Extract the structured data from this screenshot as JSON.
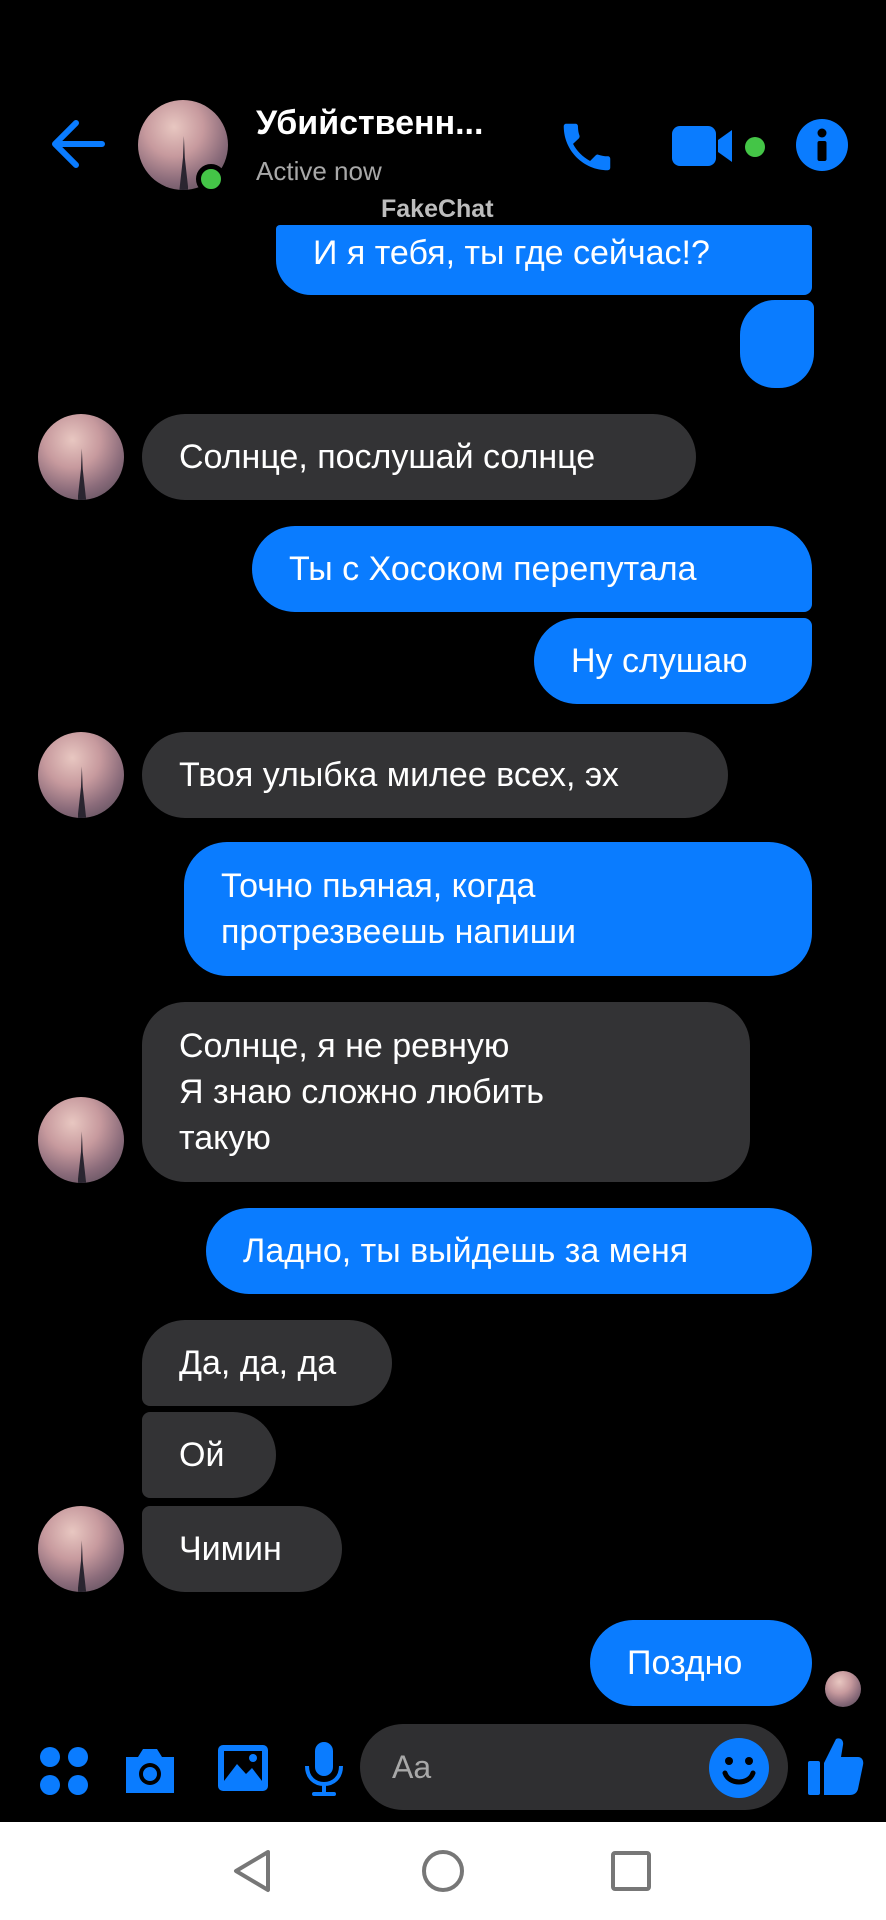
{
  "header": {
    "contact_name": "Убийственн...",
    "status": "Active now",
    "watermark": "FakeChat",
    "icons": [
      "back-arrow-icon",
      "phone-icon",
      "video-camera-icon",
      "info-icon"
    ],
    "accent_color": "#0a7cff",
    "online_color": "#44c547"
  },
  "messages": [
    {
      "dir": "out",
      "text": "И я тебя, ты где сейчас!?"
    },
    {
      "dir": "out",
      "text": ""
    },
    {
      "dir": "in",
      "text": "Солнце, послушай солнце"
    },
    {
      "dir": "out",
      "text": "Ты с Хосоком перепутала"
    },
    {
      "dir": "out",
      "text": "Ну слушаю"
    },
    {
      "dir": "in",
      "text": "Твоя улыбка милее всех, эх"
    },
    {
      "dir": "out",
      "text": "Точно пьяная, когда\nпротрезвеешь напиши"
    },
    {
      "dir": "in",
      "text": "Солнце, я не ревную\nЯ знаю сложно любить\nтакую"
    },
    {
      "dir": "out",
      "text": "Ладно, ты выйдешь за меня"
    },
    {
      "dir": "in",
      "text": "Да, да, да"
    },
    {
      "dir": "in",
      "text": "Ой"
    },
    {
      "dir": "in",
      "text": "Чимин"
    },
    {
      "dir": "out",
      "text": "Поздно"
    }
  ],
  "composer": {
    "placeholder": "Aa",
    "icons": [
      "menu-dots-icon",
      "camera-icon",
      "gallery-icon",
      "microphone-icon",
      "emoji-icon",
      "thumbs-up-icon"
    ]
  },
  "navbar": {
    "icons": [
      "nav-back-icon",
      "nav-home-icon",
      "nav-recent-icon"
    ]
  }
}
